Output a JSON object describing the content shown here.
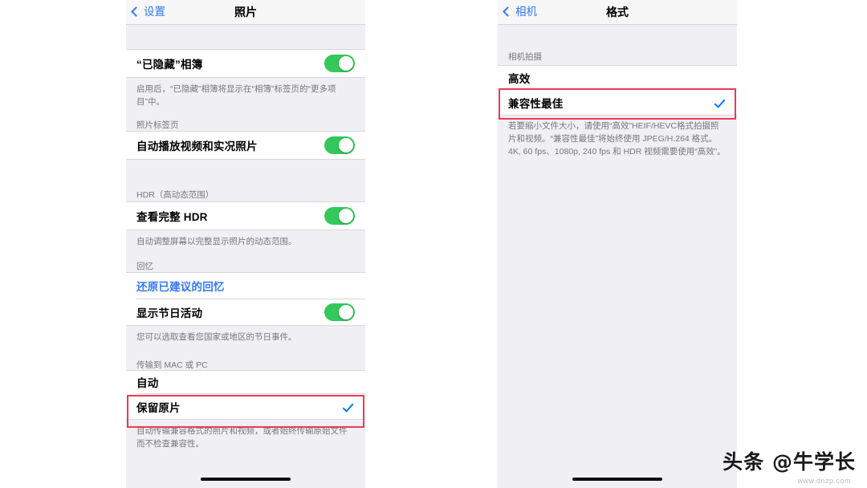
{
  "colors": {
    "accent_blue": "#3478f6",
    "check_blue": "#007aff",
    "toggle_green": "#34c759",
    "highlight_red": "#ec3b50",
    "panel_bg": "#efeff4",
    "row_bg": "#ffffff",
    "note_text": "#77777c"
  },
  "left_phone": {
    "nav": {
      "back_label": "设置",
      "title": "照片"
    },
    "rows": {
      "hidden_album": {
        "label": "“已隐藏”相簿",
        "toggle": "on"
      },
      "hidden_album_note": "启用后，“已隐藏”相簿将显示在“相簿”标签页的“更多项目”中。",
      "photos_tab_head": "照片标签页",
      "autoplay": {
        "label": "自动播放视频和实况照片",
        "toggle": "on"
      },
      "hdr_head": "HDR（高动态范围）",
      "view_full_hdr": {
        "label": "查看完整 HDR",
        "toggle": "on"
      },
      "hdr_note": "自动调整屏幕以完整显示照片的动态范围。",
      "memories_head": "回忆",
      "restore_memories": {
        "label": "还原已建议的回忆"
      },
      "holiday_events": {
        "label": "显示节日活动",
        "toggle": "on"
      },
      "holiday_note": "您可以选取查看您国家或地区的节日事件。",
      "transfer_head": "传输到 MAC 或 PC",
      "automatic": {
        "label": "自动",
        "selected": false
      },
      "keep_originals": {
        "label": "保留原片",
        "selected": true
      },
      "transfer_note": "自动传输兼容格式的照片和视频，或者始终传输原始文件而不检查兼容性。"
    }
  },
  "right_phone": {
    "nav": {
      "back_label": "相机",
      "title": "格式"
    },
    "rows": {
      "camera_capture_head": "相机拍摄",
      "high_efficiency": {
        "label": "高效",
        "selected": false
      },
      "most_compatible": {
        "label": "兼容性最佳",
        "selected": true
      },
      "format_note": "若要缩小文件大小，请使用“高效”HEIF/HEVC格式拍摄照片和视频。“兼容性最佳”将始终使用 JPEG/H.264 格式。4K, 60 fps、1080p, 240 fps 和 HDR 视频需要使用“高效”。"
    }
  },
  "watermark": {
    "text": "头条 @牛学长",
    "sub": "www.dnzp.com"
  }
}
